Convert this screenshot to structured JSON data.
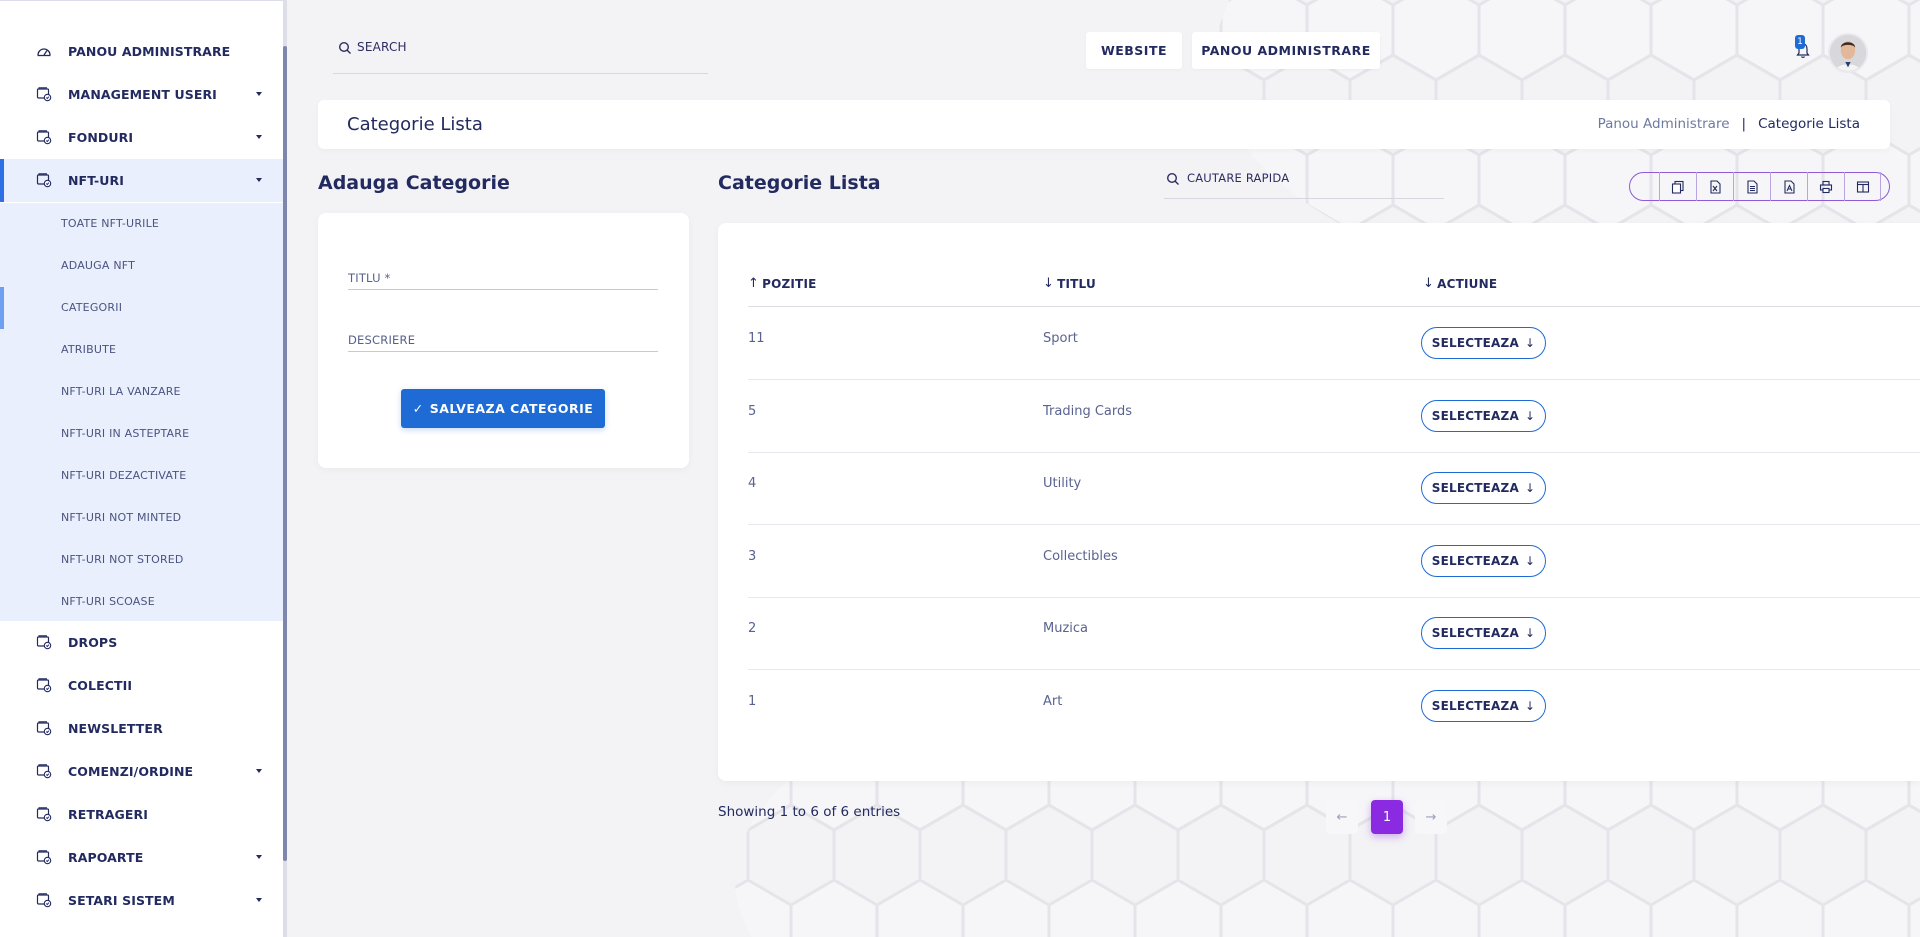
{
  "sidebar": {
    "items": [
      {
        "label": "Panou Administrare",
        "icon": "dashboard-icon",
        "caret": false
      },
      {
        "label": "Management Useri",
        "icon": "wallet-icon",
        "caret": true
      },
      {
        "label": "Fonduri",
        "icon": "wallet-icon",
        "caret": true
      },
      {
        "label": "NFT-uri",
        "icon": "wallet-icon",
        "caret": true,
        "active": true
      },
      {
        "label": "Drops",
        "icon": "wallet-icon",
        "caret": false
      },
      {
        "label": "Colectii",
        "icon": "wallet-icon",
        "caret": false
      },
      {
        "label": "Newsletter",
        "icon": "wallet-icon",
        "caret": false
      },
      {
        "label": "Comenzi/Ordine",
        "icon": "wallet-icon",
        "caret": true
      },
      {
        "label": "Retrageri",
        "icon": "wallet-icon",
        "caret": false
      },
      {
        "label": "Rapoarte",
        "icon": "wallet-icon",
        "caret": true
      },
      {
        "label": "Setari Sistem",
        "icon": "wallet-icon",
        "caret": true
      }
    ],
    "submenu": [
      {
        "label": "Toate NFT-urile"
      },
      {
        "label": "Adauga NFT"
      },
      {
        "label": "Categorii",
        "selected": true
      },
      {
        "label": "Atribute"
      },
      {
        "label": "NFT-uri la vanzare"
      },
      {
        "label": "NFT-uri in asteptare"
      },
      {
        "label": "NFT-uri dezactivate"
      },
      {
        "label": "NFT-uri not minted"
      },
      {
        "label": "NFT-uri not stored"
      },
      {
        "label": "NFT-uri scoase"
      }
    ]
  },
  "topbar": {
    "search_placeholder": "SEARCH",
    "website_label": "WEBSITE",
    "admin_label": "PANOU ADMINISTRARE",
    "notification_count": "1"
  },
  "header": {
    "title": "Categorie Lista",
    "breadcrumb": [
      "Panou Administrare",
      "|",
      "Categorie Lista"
    ]
  },
  "form": {
    "title": "Adauga Categorie",
    "titlu_placeholder": "TITLU *",
    "descriere_placeholder": "DESCRIERE",
    "save_label": "SALVEAZA CATEGORIE",
    "check_glyph": "✓"
  },
  "list": {
    "title": "Categorie Lista",
    "quick_search_placeholder": "CAUTARE RAPIDA",
    "export_buttons": [
      "copy-icon",
      "excel-icon",
      "csv-icon",
      "pdf-icon",
      "print-icon",
      "columns-icon"
    ],
    "columns": [
      {
        "label": "POZITIE",
        "arrow": "↑"
      },
      {
        "label": "TITLU",
        "arrow": "↓"
      },
      {
        "label": "ACTIUNE",
        "arrow": "↓"
      }
    ],
    "rows": [
      {
        "pozitie": "11",
        "titlu": "Sport",
        "action": "SELECTEAZA"
      },
      {
        "pozitie": "5",
        "titlu": "Trading Cards",
        "action": "SELECTEAZA"
      },
      {
        "pozitie": "4",
        "titlu": "Utility",
        "action": "SELECTEAZA"
      },
      {
        "pozitie": "3",
        "titlu": "Collectibles",
        "action": "SELECTEAZA"
      },
      {
        "pozitie": "2",
        "titlu": "Muzica",
        "action": "SELECTEAZA"
      },
      {
        "pozitie": "1",
        "titlu": "Art",
        "action": "SELECTEAZA"
      }
    ],
    "action_arrow": "↓",
    "entries_text": "Showing 1 to 6 of 6 entries",
    "pagination": {
      "prev": "←",
      "current": "1",
      "next": "→"
    }
  },
  "colors": {
    "primary": "#1e6bd6",
    "accent_purple": "#8a2be2",
    "text_dark": "#222a60",
    "sidebar_active_bg": "#e9effc"
  }
}
